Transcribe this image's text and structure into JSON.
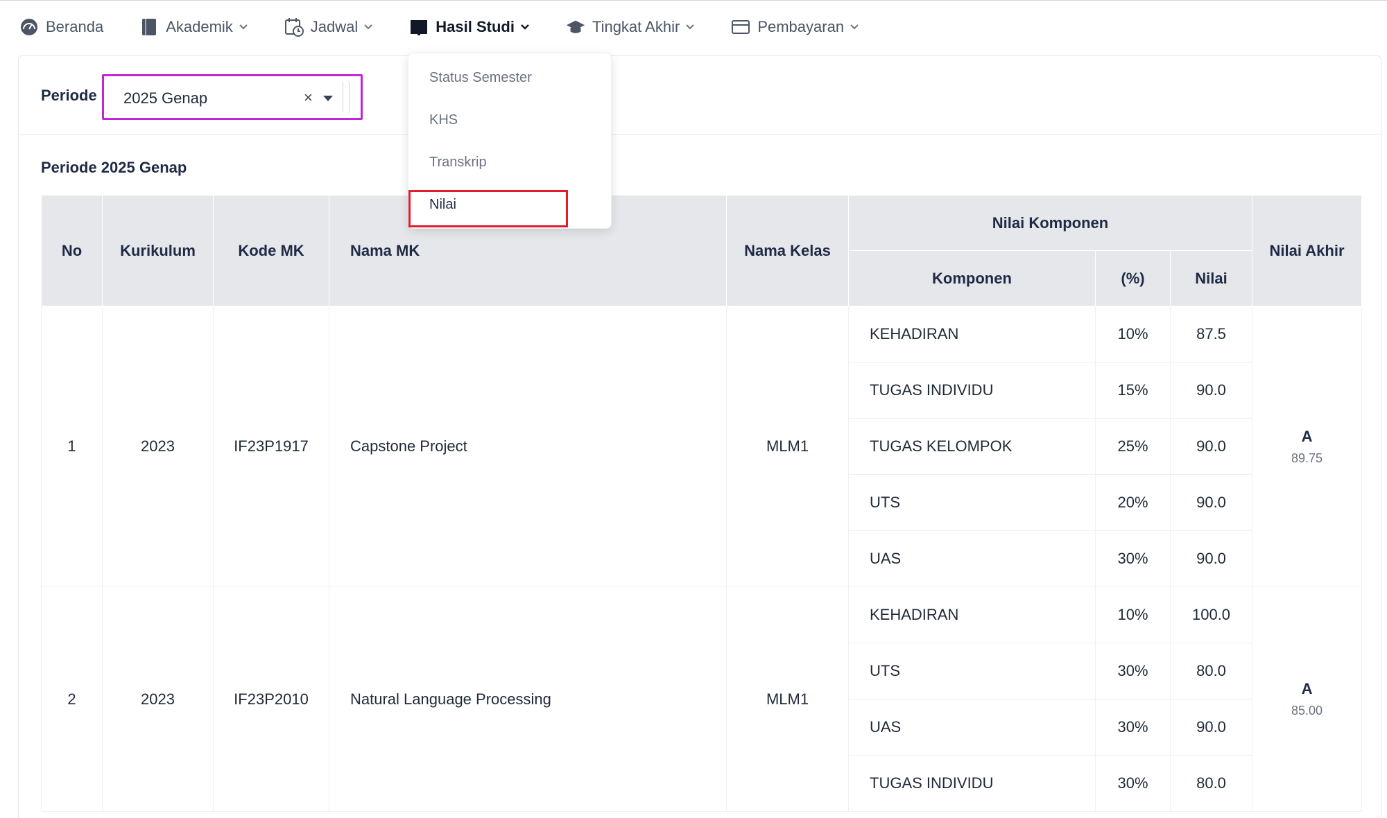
{
  "nav": {
    "items": [
      {
        "label": "Beranda",
        "icon": "dashboard-gauge-icon",
        "has_caret": false
      },
      {
        "label": "Akademik",
        "icon": "book-icon",
        "has_caret": true
      },
      {
        "label": "Jadwal",
        "icon": "calendar-clock-icon",
        "has_caret": true
      },
      {
        "label": "Hasil Studi",
        "icon": "open-book-icon",
        "has_caret": true,
        "active": true
      },
      {
        "label": "Tingkat Akhir",
        "icon": "graduation-cap-icon",
        "has_caret": true
      },
      {
        "label": "Pembayaran",
        "icon": "payment-card-icon",
        "has_caret": true
      }
    ]
  },
  "dropdown": {
    "items": [
      "Status Semester",
      "KHS",
      "Transkrip",
      "Nilai"
    ],
    "selected": "Nilai"
  },
  "filter": {
    "label": "Periode",
    "value": "2025 Genap",
    "clear_symbol": "×"
  },
  "section_title": "Periode 2025 Genap",
  "table": {
    "headers": {
      "no": "No",
      "kurikulum": "Kurikulum",
      "kode": "Kode MK",
      "nama": "Nama MK",
      "kelas": "Nama Kelas",
      "komponen_group": "Nilai Komponen",
      "komponen": "Komponen",
      "persen": "(%)",
      "nilai": "Nilai",
      "akhir": "Nilai Akhir"
    },
    "rows": [
      {
        "no": "1",
        "kurikulum": "2023",
        "kode": "IF23P1917",
        "nama": "Capstone Project",
        "kelas": "MLM1",
        "komponen": [
          {
            "nama": "KEHADIRAN",
            "persen": "10%",
            "nilai": "87.5"
          },
          {
            "nama": "TUGAS INDIVIDU",
            "persen": "15%",
            "nilai": "90.0"
          },
          {
            "nama": "TUGAS KELOMPOK",
            "persen": "25%",
            "nilai": "90.0"
          },
          {
            "nama": "UTS",
            "persen": "20%",
            "nilai": "90.0"
          },
          {
            "nama": "UAS",
            "persen": "30%",
            "nilai": "90.0"
          }
        ],
        "akhir_huruf": "A",
        "akhir_angka": "89.75"
      },
      {
        "no": "2",
        "kurikulum": "2023",
        "kode": "IF23P2010",
        "nama": "Natural Language Processing",
        "kelas": "MLM1",
        "komponen": [
          {
            "nama": "KEHADIRAN",
            "persen": "10%",
            "nilai": "100.0"
          },
          {
            "nama": "UTS",
            "persen": "30%",
            "nilai": "80.0"
          },
          {
            "nama": "UAS",
            "persen": "30%",
            "nilai": "90.0"
          },
          {
            "nama": "TUGAS INDIVIDU",
            "persen": "30%",
            "nilai": "80.0"
          }
        ],
        "akhir_huruf": "A",
        "akhir_angka": "85.00"
      }
    ]
  },
  "colors": {
    "select_highlight": "#c026d3",
    "menu_highlight": "#e11d2a",
    "header_bg": "#e5e7eb",
    "text_dark": "#1f2a44"
  }
}
